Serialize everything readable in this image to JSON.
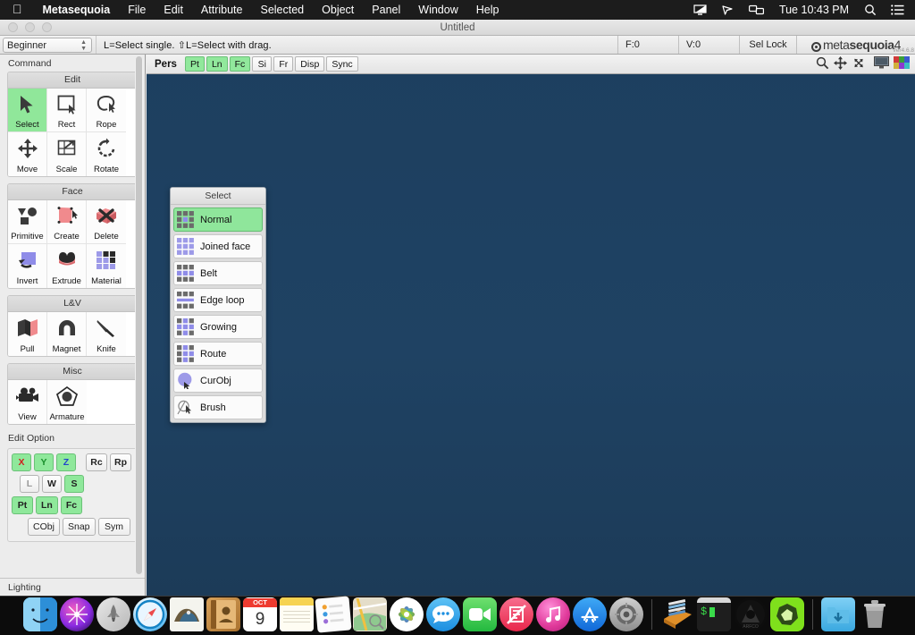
{
  "menubar": {
    "apple_icon": "apple-logo",
    "items": [
      "Metasequoia",
      "File",
      "Edit",
      "Attribute",
      "Selected",
      "Object",
      "Panel",
      "Window",
      "Help"
    ],
    "app_name": "Metasequoia",
    "status_icons": [
      "display-mirroring-icon",
      "airplay-icon",
      "screen-sharing-icon"
    ],
    "clock": "Tue 10:43 PM",
    "search_icon": "search-icon",
    "control_center_icon": "control-center-icon"
  },
  "window": {
    "title": "Untitled",
    "traffic_lights": [
      "close-button",
      "minimize-button",
      "zoom-button"
    ]
  },
  "toolstrip": {
    "mode": "Beginner",
    "hint": "L=Select single.   ⇧L=Select with drag.",
    "face_count": "F:0",
    "vertex_count": "V:0",
    "sel_lock": "Sel Lock",
    "brand_prefix": "meta",
    "brand_suffix": "sequoia",
    "brand_number": "4",
    "brand_version": "Ver4.6.8"
  },
  "command_panel": {
    "title": "Command",
    "groups": [
      {
        "name": "Edit",
        "tools": [
          {
            "label": "Select",
            "icon": "arrow-cursor-icon",
            "selected": true
          },
          {
            "label": "Rect",
            "icon": "rectangle-select-icon",
            "selected": false
          },
          {
            "label": "Rope",
            "icon": "lasso-rope-icon",
            "selected": false
          },
          {
            "label": "Move",
            "icon": "move-arrows-icon",
            "selected": false
          },
          {
            "label": "Scale",
            "icon": "scale-icon",
            "selected": false
          },
          {
            "label": "Rotate",
            "icon": "rotate-icon",
            "selected": false
          }
        ]
      },
      {
        "name": "Face",
        "tools": [
          {
            "label": "Primitive",
            "icon": "primitive-shapes-icon",
            "selected": false
          },
          {
            "label": "Create",
            "icon": "create-face-icon",
            "selected": false
          },
          {
            "label": "Delete",
            "icon": "delete-face-icon",
            "selected": false
          },
          {
            "label": "Invert",
            "icon": "invert-face-icon",
            "selected": false
          },
          {
            "label": "Extrude",
            "icon": "extrude-icon",
            "selected": false
          },
          {
            "label": "Material",
            "icon": "material-grid-icon",
            "selected": false
          }
        ]
      },
      {
        "name": "L&V",
        "tools": [
          {
            "label": "Pull",
            "icon": "pull-icon",
            "selected": false
          },
          {
            "label": "Magnet",
            "icon": "magnet-icon",
            "selected": false
          },
          {
            "label": "Knife",
            "icon": "knife-icon",
            "selected": false
          }
        ]
      },
      {
        "name": "Misc",
        "tools": [
          {
            "label": "View",
            "icon": "camera-icon",
            "selected": false
          },
          {
            "label": "Armature",
            "icon": "armature-icon",
            "selected": false
          }
        ]
      }
    ]
  },
  "edit_option": {
    "title": "Edit Option",
    "row1": [
      {
        "label": "X",
        "on": true,
        "color": "#d01f1f"
      },
      {
        "label": "Y",
        "on": true,
        "color": "#1a8f2c"
      },
      {
        "label": "Z",
        "on": true,
        "color": "#2244cc"
      },
      {
        "label": "Rc",
        "on": false,
        "color": "#222222"
      },
      {
        "label": "Rp",
        "on": false,
        "color": "#222222"
      }
    ],
    "row2": [
      {
        "label": "L",
        "on": false,
        "color": "#9a9a9a"
      },
      {
        "label": "W",
        "on": false,
        "color": "#111111"
      },
      {
        "label": "S",
        "on": true,
        "color": "#111111"
      }
    ],
    "row3": [
      {
        "label": "Pt",
        "on": true,
        "color": "#111111"
      },
      {
        "label": "Ln",
        "on": true,
        "color": "#111111"
      },
      {
        "label": "Fc",
        "on": true,
        "color": "#111111"
      }
    ],
    "row4": [
      {
        "label": "CObj",
        "on": false,
        "color": "#111111"
      },
      {
        "label": "Snap",
        "on": false,
        "color": "#111111"
      },
      {
        "label": "Sym",
        "on": false,
        "color": "#111111"
      }
    ]
  },
  "lighting": {
    "title": "Lighting"
  },
  "viewbar": {
    "projection": "Pers",
    "buttons": [
      {
        "label": "Pt",
        "on": true
      },
      {
        "label": "Ln",
        "on": true
      },
      {
        "label": "Fc",
        "on": true
      },
      {
        "label": "Si",
        "on": false
      },
      {
        "label": "Fr",
        "on": false
      },
      {
        "label": "Disp",
        "on": false
      },
      {
        "label": "Sync",
        "on": false
      }
    ],
    "icons": [
      "zoom-icon",
      "pan-icon",
      "orbit-icon",
      "monitor-icon",
      "color-swatch-icon"
    ]
  },
  "select_palette": {
    "title": "Select",
    "items": [
      {
        "label": "Normal",
        "icon": "normal-select-icon",
        "selected": true
      },
      {
        "label": "Joined face",
        "icon": "joined-face-icon",
        "selected": false
      },
      {
        "label": "Belt",
        "icon": "belt-select-icon",
        "selected": false
      },
      {
        "label": "Edge loop",
        "icon": "edge-loop-icon",
        "selected": false
      },
      {
        "label": "Growing",
        "icon": "growing-select-icon",
        "selected": false
      },
      {
        "label": "Route",
        "icon": "route-select-icon",
        "selected": false
      },
      {
        "label": "CurObj",
        "icon": "current-object-icon",
        "selected": false
      },
      {
        "label": "Brush",
        "icon": "brush-select-icon",
        "selected": false
      }
    ]
  },
  "dock": {
    "items": [
      {
        "name": "finder",
        "running": true
      },
      {
        "name": "siri",
        "running": false
      },
      {
        "name": "launchpad",
        "running": false
      },
      {
        "name": "safari",
        "running": false
      },
      {
        "name": "mail",
        "running": false
      },
      {
        "name": "contacts",
        "running": false
      },
      {
        "name": "calendar",
        "running": false,
        "month": "OCT",
        "day": "9"
      },
      {
        "name": "notes",
        "running": false
      },
      {
        "name": "reminders",
        "running": false
      },
      {
        "name": "maps",
        "running": false
      },
      {
        "name": "photos",
        "running": false
      },
      {
        "name": "messages",
        "running": false
      },
      {
        "name": "facetime",
        "running": false
      },
      {
        "name": "news",
        "running": false
      },
      {
        "name": "itunes",
        "running": false
      },
      {
        "name": "app-store",
        "running": false
      },
      {
        "name": "system-preferences",
        "running": false
      },
      {
        "name": "xcode-books",
        "running": false
      },
      {
        "name": "terminal",
        "running": false
      },
      {
        "name": "arduino",
        "running": true
      },
      {
        "name": "metasequoia",
        "running": true
      },
      {
        "name": "downloads-folder",
        "running": false
      },
      {
        "name": "trash",
        "running": false
      }
    ]
  }
}
